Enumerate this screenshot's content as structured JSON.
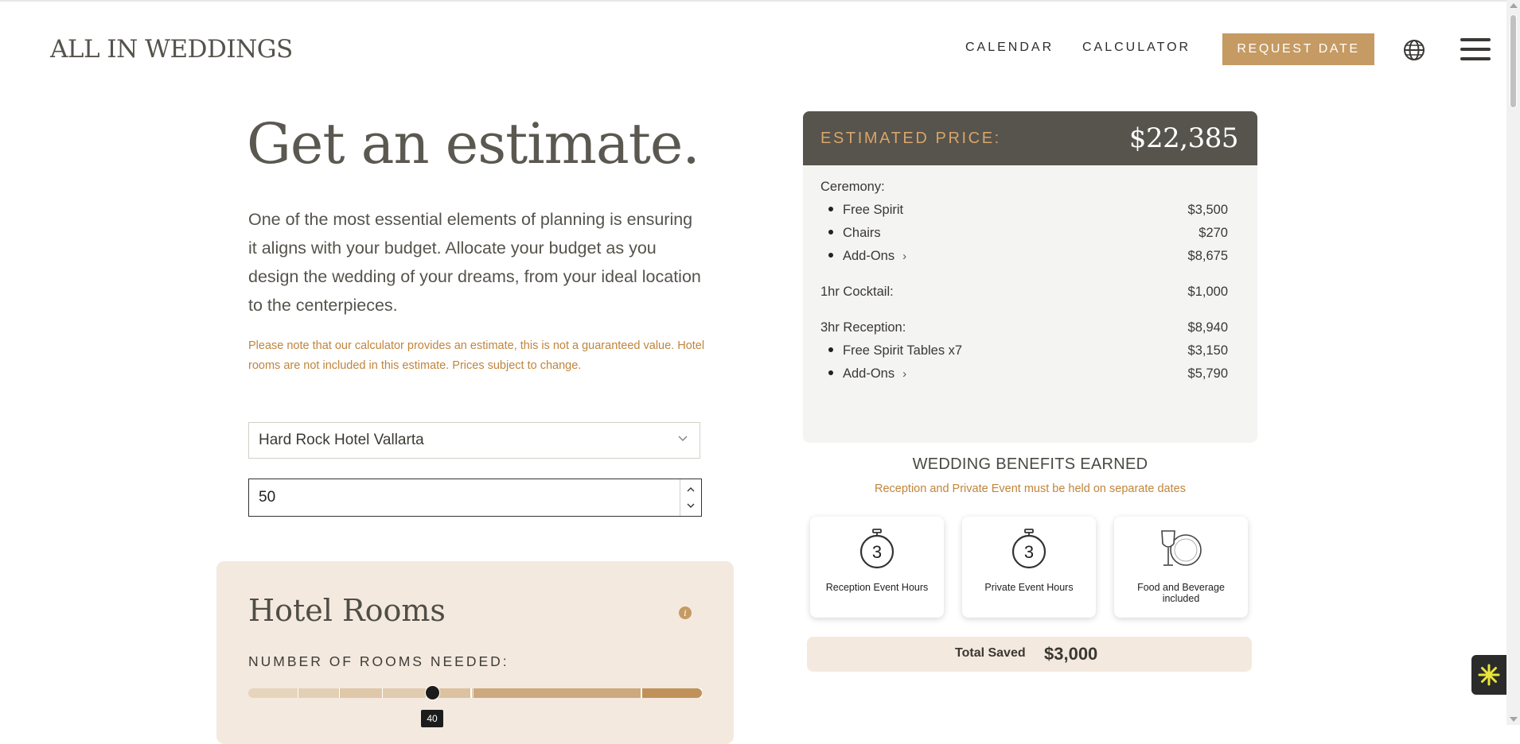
{
  "header": {
    "logo": "ALL IN WEDDINGS",
    "nav": [
      "CALENDAR",
      "CALCULATOR"
    ],
    "request_button": "REQUEST DATE"
  },
  "main": {
    "title": "Get an estimate.",
    "intro": "One of the most essential elements of planning is ensuring it aligns with your budget. Allocate your budget as you design the wedding of your dreams, from your ideal location to the centerpieces.",
    "note": "Please note that our calculator provides an estimate, this is not a guaranteed value. Hotel rooms are not included in this estimate. Prices subject to change.",
    "venue_select": "Hard Rock Hotel Vallarta",
    "guests_value": "50"
  },
  "hotel_rooms": {
    "title": "Hotel Rooms",
    "label": "NUMBER OF ROOMS NEEDED:",
    "slider_value": "40"
  },
  "estimate": {
    "label": "ESTIMATED PRICE:",
    "total": "$22,385",
    "ceremony": {
      "label": "Ceremony:",
      "items": [
        {
          "name": "Free Spirit",
          "amount": "$3,500"
        },
        {
          "name": "Chairs",
          "amount": "$270"
        },
        {
          "name": "Add-Ons",
          "amount": "$8,675"
        }
      ]
    },
    "cocktail": {
      "label": "1hr Cocktail:",
      "amount": "$1,000"
    },
    "reception": {
      "label": "3hr Reception:",
      "amount": "$8,940",
      "items": [
        {
          "name": "Free Spirit Tables x7",
          "amount": "$3,150"
        },
        {
          "name": "Add-Ons",
          "amount": "$5,790"
        }
      ]
    }
  },
  "benefits": {
    "title": "WEDDING BENEFITS EARNED",
    "note": "Reception and Private Event must be held on separate dates",
    "cards": [
      {
        "icon": "stopwatch-icon",
        "number": "3",
        "label": "Reception Event Hours"
      },
      {
        "icon": "stopwatch-icon",
        "number": "3",
        "label": "Private Event Hours"
      },
      {
        "icon": "wine-plate-icon",
        "label": "Food and Beverage included"
      }
    ],
    "saved_label": "Total Saved",
    "saved_value": "$3,000"
  },
  "colors": {
    "accent": "#c59a63",
    "dark_panel": "#56544c",
    "beige": "#f3e9df"
  }
}
